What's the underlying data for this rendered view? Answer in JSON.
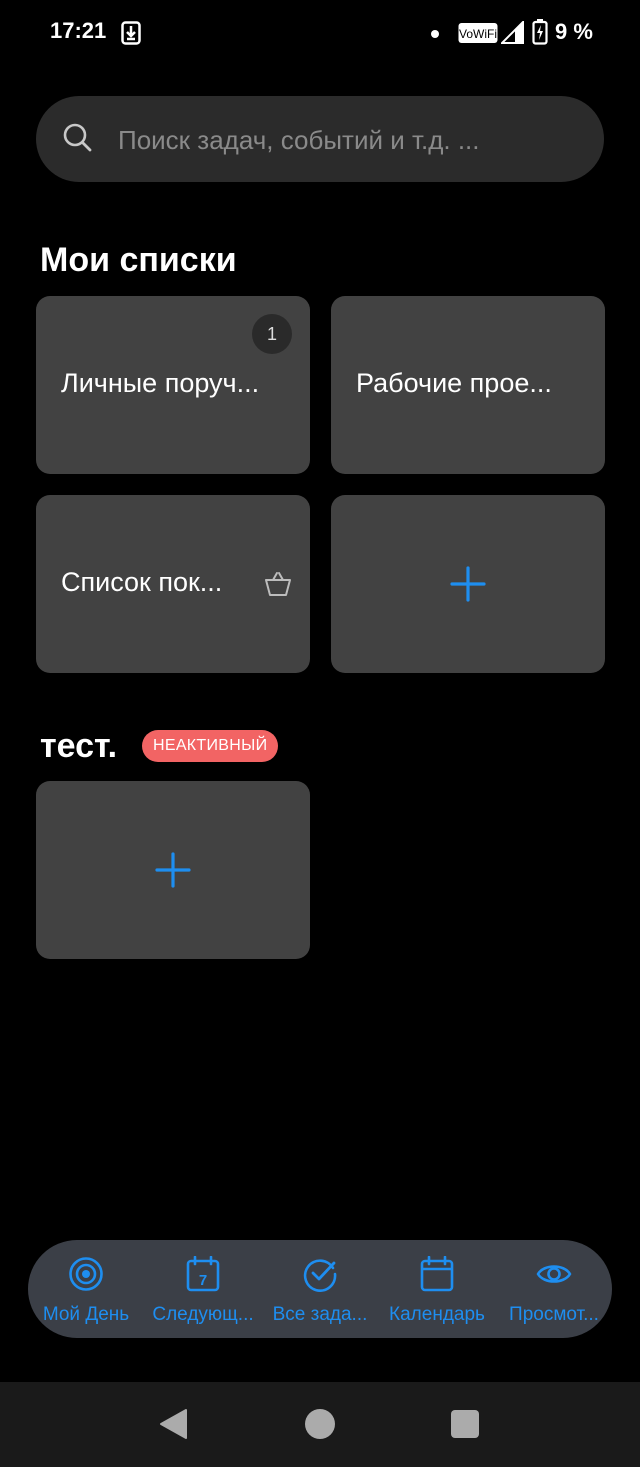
{
  "status_bar": {
    "time": "17:21",
    "vowifi": "VoWiFi",
    "battery": "9 %"
  },
  "search": {
    "placeholder": "Поиск задач, событий и т.д. ..."
  },
  "my_lists": {
    "title": "Мои списки",
    "tiles": [
      {
        "label": "Личные поруч...",
        "badge": "1"
      },
      {
        "label": "Рабочие прое..."
      },
      {
        "label": "Список пок...",
        "icon": "basket-icon"
      },
      {
        "label": "",
        "icon": "plus-icon"
      }
    ]
  },
  "test_group": {
    "title": "тест.",
    "status_badge": "НЕАКТИВНЫЙ",
    "tiles": [
      {
        "label": "",
        "icon": "plus-icon"
      }
    ]
  },
  "bottom_nav": {
    "items": [
      {
        "label": "Мой День",
        "icon": "target-icon"
      },
      {
        "label": "Следующ...",
        "icon": "calendar-7-icon",
        "icon_text": "7"
      },
      {
        "label": "Все зада...",
        "icon": "check-circle-icon"
      },
      {
        "label": "Календарь",
        "icon": "calendar-icon"
      },
      {
        "label": "Просмот...",
        "icon": "eye-icon"
      }
    ]
  },
  "colors": {
    "accent": "#1e8ef0",
    "tile_bg": "#424242",
    "badge_inactive": "#f26464",
    "nav_bg": "#3b3f47"
  }
}
